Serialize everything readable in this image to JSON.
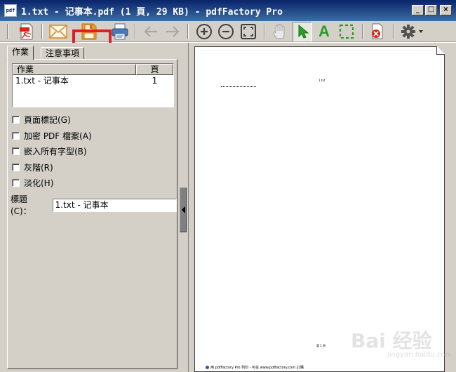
{
  "window": {
    "app_icon": "pdf",
    "title": "1.txt - 记事本.pdf (1 頁, 29 KB) - pdfFactory Pro",
    "minimize": "_",
    "maximize": "□",
    "close": "×"
  },
  "toolbar": {
    "buttons": [
      {
        "name": "pdf-icon"
      },
      {
        "name": "mail-icon"
      },
      {
        "name": "save-icon"
      },
      {
        "name": "print-icon"
      },
      {
        "name": "back-arrow-icon"
      },
      {
        "name": "forward-arrow-icon"
      },
      {
        "name": "zoom-in-icon"
      },
      {
        "name": "zoom-out-icon"
      },
      {
        "name": "fit-page-icon"
      },
      {
        "name": "hand-tool-icon"
      },
      {
        "name": "select-arrow-icon"
      },
      {
        "name": "text-select-icon"
      },
      {
        "name": "marquee-select-icon"
      },
      {
        "name": "delete-page-icon"
      },
      {
        "name": "settings-gear-icon"
      }
    ],
    "text_tool_glyph": "A",
    "accent_highlight": "#e0201e"
  },
  "tabs": [
    {
      "label": "作業"
    },
    {
      "label": "注意事項"
    }
  ],
  "jobs": {
    "columns": [
      "作業",
      "頁"
    ],
    "rows": [
      {
        "name": "1.txt - 记事本",
        "pages": "1"
      }
    ]
  },
  "options": [
    {
      "label": "頁面標記(G)"
    },
    {
      "label": "加密 PDF 檔案(A)"
    },
    {
      "label": "嵌入所有字型(B)"
    },
    {
      "label": "灰階(R)"
    },
    {
      "label": "淡化(H)"
    }
  ],
  "title_field": {
    "label": "標題(C)：",
    "value": "1.txt - 记事本"
  },
  "preview": {
    "header_text": "1.txt",
    "footer_page": "第 1 頁",
    "footer_note": "用 pdfFactory Pro 列印 - 可在 www.pdffactory.com 訂購"
  },
  "watermark": {
    "text": "Bai 经验",
    "sub": "jingyan.baidu.com"
  }
}
